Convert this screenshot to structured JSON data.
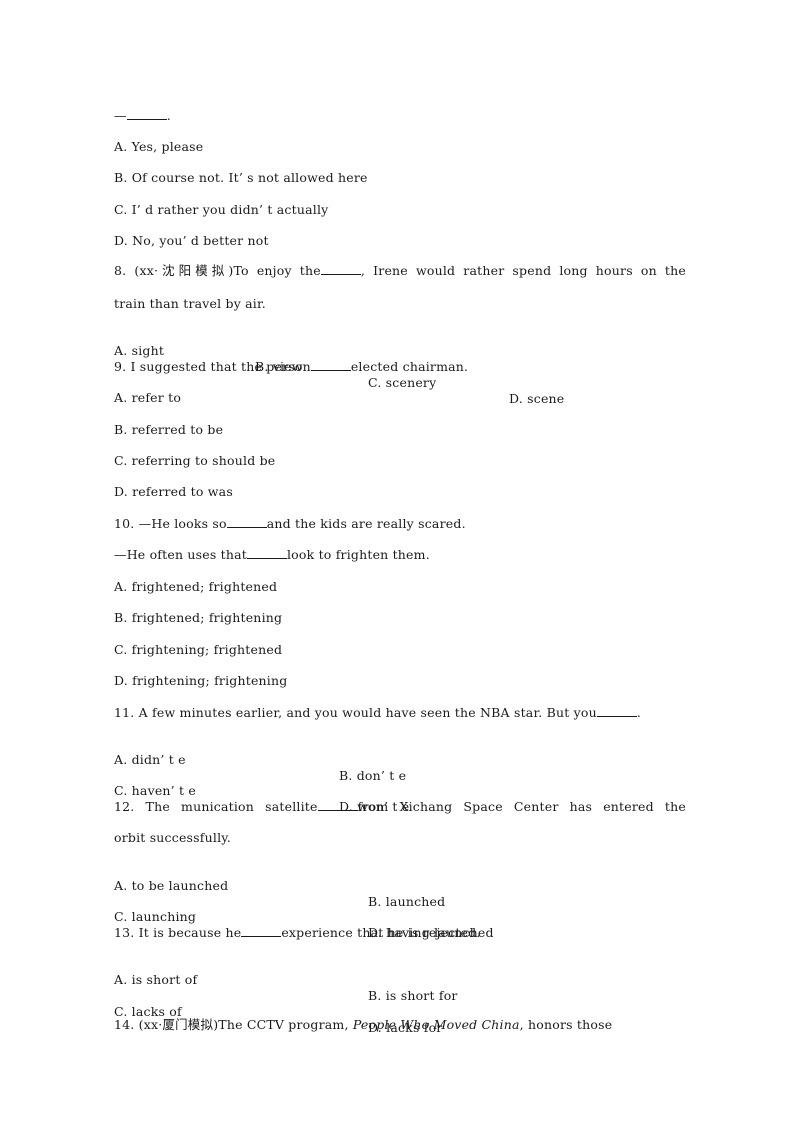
{
  "document": {
    "q7_tail": {
      "dash": "—",
      "end": ".",
      "options": [
        "A. Yes, please",
        "B. Of course not. It’ s not allowed here",
        "C. I’ d rather you didn’ t actually",
        "D. No, you’ d better not"
      ]
    },
    "q8": {
      "prefix": "8. (xx·沈阳模拟)To enjoy the",
      "suffix": ", Irene would rather spend long hours on the",
      "line2": "train than travel by air.",
      "options": [
        "A. sight",
        "B. view",
        "C. scenery",
        "D. scene"
      ]
    },
    "q9": {
      "prefix": "9. I suggested that the person",
      "suffix": "elected chairman.",
      "options": [
        "A. refer to",
        "B. referred to be",
        "C. referring to should be",
        "D. referred to was"
      ]
    },
    "q10": {
      "line1_prefix": "10. —He looks so",
      "line1_suffix": "and the kids are really scared.",
      "line2_prefix": "—He often uses that",
      "line2_suffix": "look to frighten them.",
      "options": [
        "A. frightened; frightened",
        "B. frightened; frightening",
        "C. frightening; frightened",
        "D. frightening; frightening"
      ]
    },
    "q11": {
      "prefix": "11. A few minutes earlier, and you would have seen the NBA star. But you",
      "suffix": ".",
      "options": [
        "A. didn’ t e",
        "B. don’ t e",
        "C. haven’ t e",
        "D. won’ t e"
      ]
    },
    "q12": {
      "prefix": "12. The munication satellite",
      "suffix": "from Xichang Space Center has entered the",
      "line2": "orbit successfully.",
      "options": [
        "A. to be launched",
        "B. launched",
        "C. launching",
        "D. having launched"
      ]
    },
    "q13": {
      "prefix": "13. It is because he",
      "suffix": "experience that he is rejected.",
      "options": [
        "A. is short of",
        "B. is short for",
        "C. lacks of",
        "D. lacks for"
      ]
    },
    "q14": {
      "prefix": "14. (xx·厦门模拟)The CCTV program, ",
      "italic": "People Who Moved China",
      "suffix": ", honors those"
    }
  }
}
